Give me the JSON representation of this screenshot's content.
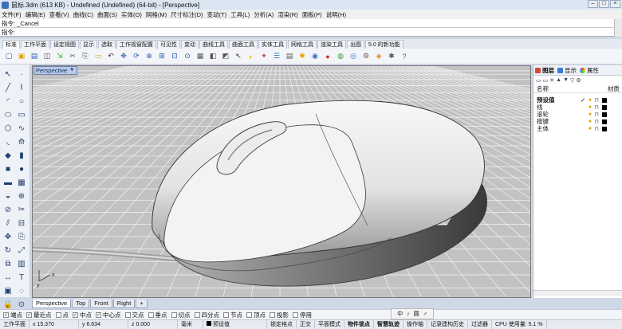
{
  "window": {
    "title": "鼠标.3dm (613 KB) - Undefined (Undefined) (64-bit) - [Perspective]",
    "min_icon": "minimize-icon",
    "max_icon": "maximize-icon",
    "close_icon": "close-icon"
  },
  "menu": [
    "文件(F)",
    "编辑(E)",
    "查看(V)",
    "曲线(C)",
    "曲面(S)",
    "实体(O)",
    "网格(M)",
    "尺寸标注(D)",
    "变动(T)",
    "工具(L)",
    "分析(A)",
    "渲染(R)",
    "面板(P)",
    "说明(H)"
  ],
  "command": {
    "history": "指令: _Cancel",
    "prompt": "指令:"
  },
  "toolbar_tabs": [
    "标准",
    "工作平面",
    "设定视图",
    "显示",
    "选取",
    "工作视窗配置",
    "可见性",
    "变动",
    "曲线工具",
    "曲面工具",
    "实体工具",
    "网格工具",
    "渲染工具",
    "出图",
    "5.0 的新功能"
  ],
  "toolbar_icons": [
    "new-file-icon",
    "open-icon",
    "save-icon",
    "print-icon",
    "import-icon",
    "cut-icon",
    "copy-icon",
    "paste-icon",
    "undo-icon",
    "pan-icon",
    "rotate-view-icon",
    "zoom-icon",
    "zoom-window-icon",
    "zoom-extents-icon",
    "zoom-selected-icon",
    "four-viewports-icon",
    "named-view-icon",
    "construction-plane-icon",
    "select-icon",
    "hide-icon",
    "lock-icon",
    "layer-icon",
    "properties-icon",
    "lights-icon",
    "material-icon",
    "render-icon",
    "render-preview-icon",
    "sphere-icon",
    "options-icon",
    "osnap-icon",
    "gear-icon",
    "help-icon"
  ],
  "viewport": {
    "label": "Perspective",
    "axis_x": "x",
    "axis_y": "y"
  },
  "viewport_tabs": [
    "Perspective",
    "Top",
    "Front",
    "Right",
    "+"
  ],
  "panel": {
    "tabs": [
      "图层",
      "显示",
      "属性"
    ],
    "col_name": "名称",
    "col_material": "材质",
    "layers": [
      {
        "name": "预设值",
        "current": "✓",
        "bold": true
      },
      {
        "name": "线"
      },
      {
        "name": "滚轮"
      },
      {
        "name": "按键"
      },
      {
        "name": "主体"
      }
    ]
  },
  "osnaps": [
    {
      "label": "端点",
      "checked": true
    },
    {
      "label": "最近点",
      "checked": true
    },
    {
      "label": "点",
      "checked": false
    },
    {
      "label": "中点",
      "checked": true
    },
    {
      "label": "中心点",
      "checked": true
    },
    {
      "label": "交点",
      "checked": false
    },
    {
      "label": "垂点",
      "checked": false
    },
    {
      "label": "切点",
      "checked": false
    },
    {
      "label": "四分点",
      "checked": false
    },
    {
      "label": "节点",
      "checked": false
    },
    {
      "label": "顶点",
      "checked": false
    },
    {
      "label": "投影",
      "checked": false
    },
    {
      "label": "停用",
      "checked": false
    }
  ],
  "status": {
    "plane": "工作平面",
    "x": "x 15.370",
    "y": "y 6.634",
    "z": "z 0.000",
    "units": "毫米",
    "layer": "预设值",
    "grid_snap": "锁定格点",
    "ortho": "正交",
    "planar": "平面模式",
    "object_snap": "物件锁点",
    "smart_track": "智慧轨迹",
    "gumball": "操作轴",
    "history": "记录建构历史",
    "filter": "过滤器",
    "cpu": "CPU 使用量: 5.1 %"
  },
  "mini_controls": [
    "中",
    "♪",
    "圆",
    "♂"
  ]
}
